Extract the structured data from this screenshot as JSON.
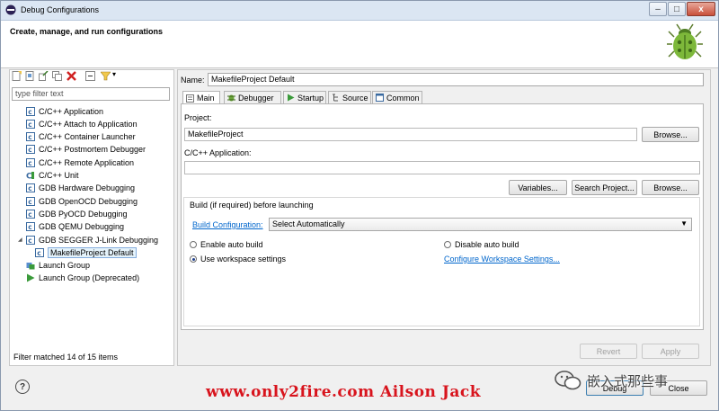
{
  "window": {
    "title": "Debug Configurations",
    "controls": {
      "minimize": "–",
      "maximize": "□",
      "close": "x"
    }
  },
  "header": {
    "title": "Create, manage, and run configurations"
  },
  "left": {
    "filter_placeholder": "type filter text",
    "tree": [
      {
        "label": "C/C++ Application",
        "icon": "c-app-icon"
      },
      {
        "label": "C/C++ Attach to Application",
        "icon": "c-app-icon"
      },
      {
        "label": "C/C++ Container Launcher",
        "icon": "c-app-icon"
      },
      {
        "label": "C/C++ Postmortem Debugger",
        "icon": "c-app-icon"
      },
      {
        "label": "C/C++ Remote Application",
        "icon": "c-app-icon"
      },
      {
        "label": "C/C++ Unit",
        "icon": "c-unit-icon"
      },
      {
        "label": "GDB Hardware Debugging",
        "icon": "c-app-icon"
      },
      {
        "label": "GDB OpenOCD Debugging",
        "icon": "c-app-icon"
      },
      {
        "label": "GDB PyOCD Debugging",
        "icon": "c-app-icon"
      },
      {
        "label": "GDB QEMU Debugging",
        "icon": "c-app-icon"
      },
      {
        "label": "GDB SEGGER J-Link Debugging",
        "icon": "c-app-icon",
        "expanded": true
      },
      {
        "label": "MakefileProject Default",
        "icon": "c-config-icon",
        "selected": true
      },
      {
        "label": "Launch Group",
        "icon": "launch-group-icon"
      },
      {
        "label": "Launch Group (Deprecated)",
        "icon": "run-icon"
      }
    ],
    "status": "Filter matched 14 of 15 items"
  },
  "right": {
    "name_label": "Name:",
    "name_value": "MakefileProject Default",
    "tabs": [
      {
        "label": "Main",
        "icon": "main-icon",
        "active": true
      },
      {
        "label": "Debugger",
        "icon": "debugger-icon"
      },
      {
        "label": "Startup",
        "icon": "startup-icon"
      },
      {
        "label": "Source",
        "icon": "source-icon"
      },
      {
        "label": "Common",
        "icon": "common-icon"
      }
    ],
    "project_label": "Project:",
    "project_value": "MakefileProject",
    "browse_label": "Browse...",
    "app_label": "C/C++ Application:",
    "app_value": "",
    "variables_label": "Variables...",
    "search_project_label": "Search Project...",
    "browse2_label": "Browse...",
    "build_group_title": "Build (if required) before launching",
    "build_config_link": "Build Configuration:",
    "build_config_value": "Select Automatically",
    "enable_auto": "Enable auto build",
    "disable_auto": "Disable auto build",
    "use_workspace": "Use workspace settings",
    "configure_link": "Configure Workspace Settings...",
    "revert_label": "Revert",
    "apply_label": "Apply"
  },
  "footer": {
    "help": "?",
    "debug_label": "Debug",
    "close_label": "Close"
  },
  "watermark": {
    "url": "www.only2fire.com Ailson Jack",
    "cn": "嵌入式那些事"
  }
}
